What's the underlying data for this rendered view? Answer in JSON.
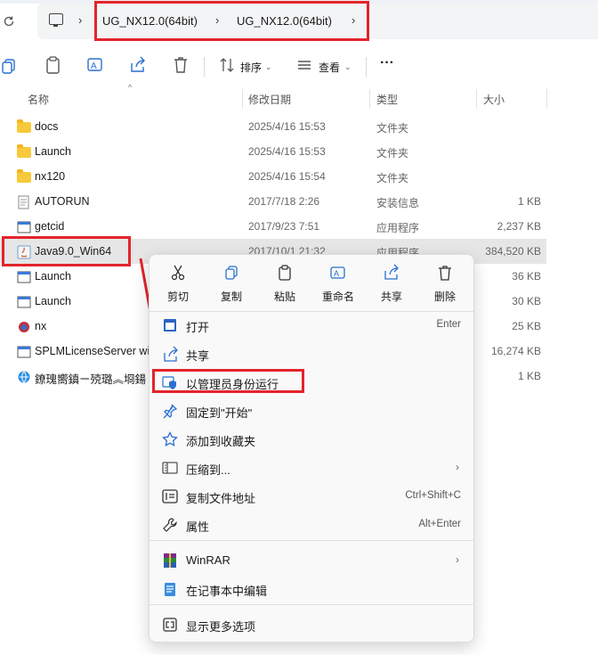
{
  "address_bar": {
    "home_icon": "monitor-icon",
    "breadcrumbs": [
      "UG_NX12.0(64bit)",
      "UG_NX12.0(64bit)"
    ]
  },
  "toolbar": {
    "sort_label": "排序",
    "view_label": "查看",
    "more_label": "···"
  },
  "columns": {
    "name": "名称",
    "modified": "修改日期",
    "type": "类型",
    "size": "大小"
  },
  "files": [
    {
      "name": "docs",
      "date": "2025/4/16 15:53",
      "type": "文件夹",
      "size": "",
      "icon": "folder-icon"
    },
    {
      "name": "Launch",
      "date": "2025/4/16 15:53",
      "type": "文件夹",
      "size": "",
      "icon": "folder-icon"
    },
    {
      "name": "nx120",
      "date": "2025/4/16 15:54",
      "type": "文件夹",
      "size": "",
      "icon": "folder-icon"
    },
    {
      "name": "AUTORUN",
      "date": "2017/7/18 2:26",
      "type": "安装信息",
      "size": "1 KB",
      "icon": "setup-info-icon"
    },
    {
      "name": "getcid",
      "date": "2017/9/23 7:51",
      "type": "应用程序",
      "size": "2,237 KB",
      "icon": "app-icon"
    },
    {
      "name": "Java9.0_Win64",
      "date": "2017/10/1 21:32",
      "type": "应用程序",
      "size": "384,520 KB",
      "icon": "java-icon"
    },
    {
      "name": "Launch",
      "date": "",
      "type": "",
      "size": "36 KB",
      "icon": "app-icon"
    },
    {
      "name": "Launch",
      "date": "",
      "type": "",
      "size": "30 KB",
      "icon": "app-icon"
    },
    {
      "name": "nx",
      "date": "",
      "type": "",
      "size": "25 KB",
      "icon": "nx-icon"
    },
    {
      "name": "SPLMLicenseServer wi",
      "date": "",
      "type": "",
      "size": "16,274 KB",
      "icon": "app-icon"
    },
    {
      "name": "鐐瑰嚮鎮ㄧ殑璐︽埛鍚",
      "date": "",
      "type": "",
      "size": "1 KB",
      "icon": "web-shortcut-icon"
    }
  ],
  "context_menu": {
    "quick_actions": [
      {
        "label": "剪切",
        "icon": "scissors-icon"
      },
      {
        "label": "复制",
        "icon": "copy-icon"
      },
      {
        "label": "粘贴",
        "icon": "paste-icon"
      },
      {
        "label": "重命名",
        "icon": "rename-icon"
      },
      {
        "label": "共享",
        "icon": "share-icon"
      },
      {
        "label": "删除",
        "icon": "trash-icon"
      }
    ],
    "items": [
      {
        "label": "打开",
        "shortcut": "Enter",
        "icon": "open-icon"
      },
      {
        "label": "共享",
        "shortcut": "",
        "icon": "share-icon"
      },
      {
        "label": "以管理员身份运行",
        "shortcut": "",
        "icon": "shield-icon"
      },
      {
        "label": "固定到\"开始\"",
        "shortcut": "",
        "icon": "pin-icon"
      },
      {
        "label": "添加到收藏夹",
        "shortcut": "",
        "icon": "star-icon"
      },
      {
        "label": "压缩到...",
        "shortcut": "",
        "icon": "zip-icon",
        "submenu": true
      },
      {
        "label": "复制文件地址",
        "shortcut": "Ctrl+Shift+C",
        "icon": "copy-path-icon"
      },
      {
        "label": "属性",
        "shortcut": "Alt+Enter",
        "icon": "wrench-icon"
      },
      {
        "label": "WinRAR",
        "shortcut": "",
        "icon": "winrar-icon",
        "submenu": true
      },
      {
        "label": "在记事本中编辑",
        "shortcut": "",
        "icon": "notepad-icon"
      },
      {
        "label": "显示更多选项",
        "shortcut": "",
        "icon": "more-options-icon"
      }
    ],
    "submenu_arrow": "›"
  },
  "colors": {
    "highlight_red": "#e3242b",
    "accent_blue": "#0067c0",
    "selected_row": "#e6e6e6"
  }
}
